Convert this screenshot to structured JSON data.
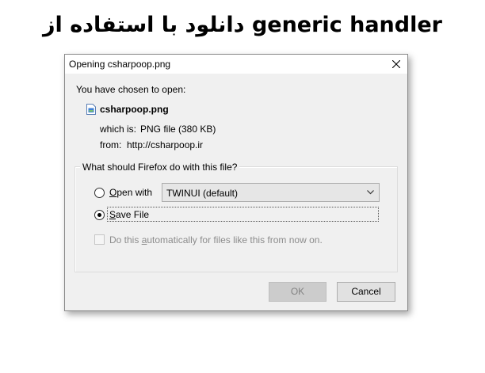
{
  "headline": "دانلود با استفاده از generic handler",
  "dialog": {
    "title": "Opening csharpoop.png",
    "chosen_label": "You have chosen to open:",
    "file_name": "csharpoop.png",
    "which_is_label": "which is:",
    "which_is_value": "PNG file (380 KB)",
    "from_label": "from:",
    "from_value": "http://csharpoop.ir",
    "group_title": "What should Firefox do with this file?",
    "open_with_prefix": "O",
    "open_with_rest": "pen with",
    "open_with_app": "TWINUI (default)",
    "save_file_prefix": "S",
    "save_file_rest": "ave File",
    "selected_option": "save_file",
    "auto_pre": "Do this ",
    "auto_u": "a",
    "auto_post": "utomatically for files like this from now on.",
    "auto_checked": false,
    "ok_label": "OK",
    "cancel_label": "Cancel"
  },
  "icons": {
    "close": "close-icon",
    "file": "png-file-icon",
    "dropdown": "chevron-down-icon"
  }
}
